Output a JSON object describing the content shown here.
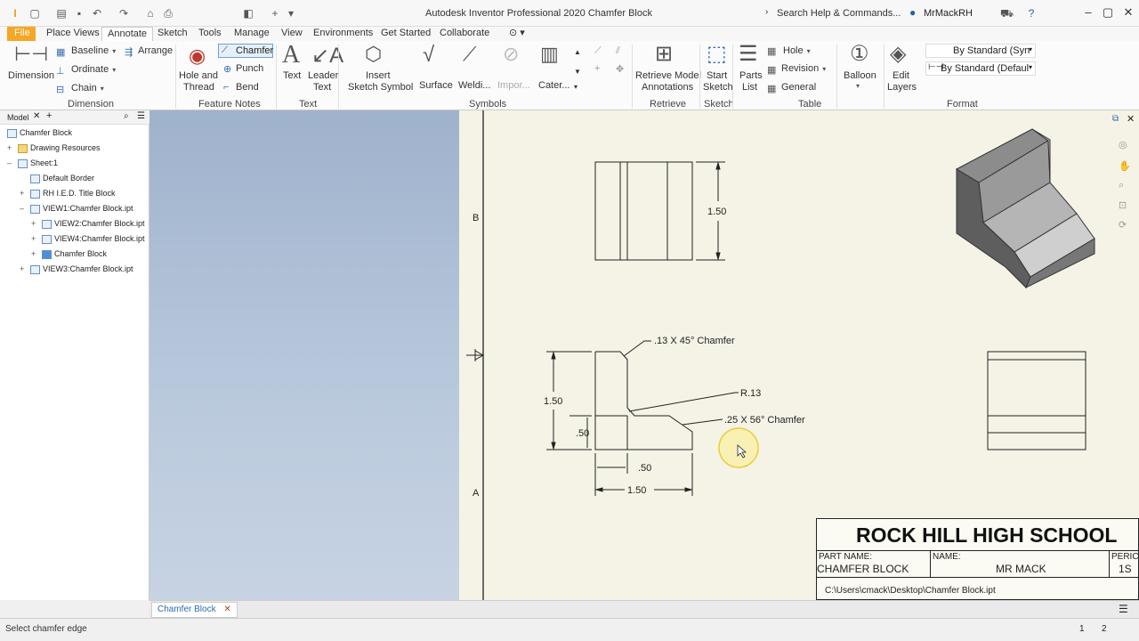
{
  "titlebar": {
    "app_title": "Autodesk Inventor Professional 2020   Chamfer Block",
    "search_placeholder": "Search Help & Commands...",
    "user": "MrMackRH"
  },
  "tabs": [
    "File",
    "Place Views",
    "Annotate",
    "Sketch",
    "Tools",
    "Manage",
    "View",
    "Environments",
    "Get Started",
    "Collaborate"
  ],
  "ribbon": {
    "dimension": {
      "big": "Dimension",
      "baseline": "Baseline",
      "ordinate": "Ordinate",
      "chain": "Chain",
      "arrange": "Arrange",
      "title": "Dimension"
    },
    "feature_notes": {
      "hole_thread_1": "Hole and",
      "hole_thread_2": "Thread",
      "chamfer": "Chamfer",
      "punch": "Punch",
      "bend": "Bend",
      "title": "Feature Notes"
    },
    "text": {
      "text": "Text",
      "leader_1": "Leader",
      "leader_2": "Text",
      "title": "Text"
    },
    "symbols": {
      "insert_1": "Insert",
      "insert_2": "Sketch Symbol",
      "surface": "Surface",
      "welding": "Weldi...",
      "import": "Impor...",
      "caterpillar": "Cater...",
      "title": "Symbols"
    },
    "retrieve": {
      "line1": "Retrieve Model",
      "line2": "Annotations",
      "title": "Retrieve"
    },
    "sketch": {
      "line1": "Start",
      "line2": "Sketch",
      "title": "Sketch"
    },
    "table": {
      "parts_1": "Parts",
      "parts_2": "List",
      "hole": "Hole",
      "revision": "Revision",
      "general": "General",
      "title": "Table"
    },
    "balloon": "Balloon",
    "edit_layers_1": "Edit",
    "edit_layers_2": "Layers",
    "format": {
      "style1": "By Standard (Syn",
      "style2": "By Standard (Defaul",
      "title": "Format"
    }
  },
  "browser": {
    "tab": "Model",
    "items": [
      "Chamfer Block",
      "Drawing Resources",
      "Sheet:1",
      "Default Border",
      "RH I.E.D. Title Block",
      "VIEW1:Chamfer Block.ipt",
      "VIEW2:Chamfer Block.ipt",
      "VIEW4:Chamfer Block.ipt",
      "Chamfer Block",
      "VIEW3:Chamfer Block.ipt"
    ]
  },
  "drawing": {
    "zone_b": "B",
    "zone_a": "A",
    "dim_top_height": "1.50",
    "note_chamfer_45": ".13 X 45° Chamfer",
    "note_radius": "R.13",
    "note_chamfer_56": ".25 X 56° Chamfer",
    "dim_front_height": "1.50",
    "dim_step_height": ".50",
    "dim_step_width": ".50",
    "dim_front_width": "1.50"
  },
  "title_block": {
    "school": "ROCK HILL HIGH SCHOOL",
    "part_name_label": "PART NAME:",
    "part_name": "CHAMFER BLOCK",
    "name_label": "NAME:",
    "name": "MR MACK",
    "period_label": "PERIC",
    "period": "1S",
    "path": "C:\\Users\\cmack\\Desktop\\Chamfer Block.ipt"
  },
  "doc_tab": "Chamfer Block",
  "status": {
    "text": "Select chamfer edge",
    "page1": "1",
    "page2": "2"
  },
  "colors": {
    "file_tab": "#f5a623",
    "sheet": "#f4f3e6",
    "accent": "#2b6cb0"
  }
}
